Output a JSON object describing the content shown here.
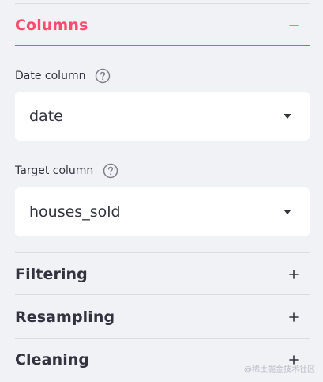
{
  "sections": {
    "columns": {
      "title": "Columns",
      "toggle": "collapse",
      "accent": "#ff4b6e"
    },
    "filtering": {
      "title": "Filtering",
      "toggle": "expand"
    },
    "resampling": {
      "title": "Resampling",
      "toggle": "expand"
    },
    "cleaning": {
      "title": "Cleaning",
      "toggle": "expand"
    }
  },
  "fields": {
    "date_column": {
      "label": "Date column",
      "value": "date",
      "help_icon": "question-circle-icon"
    },
    "target_column": {
      "label": "Target column",
      "value": "houses_sold",
      "help_icon": "question-circle-icon"
    }
  },
  "watermark": "@稀土掘金技术社区"
}
